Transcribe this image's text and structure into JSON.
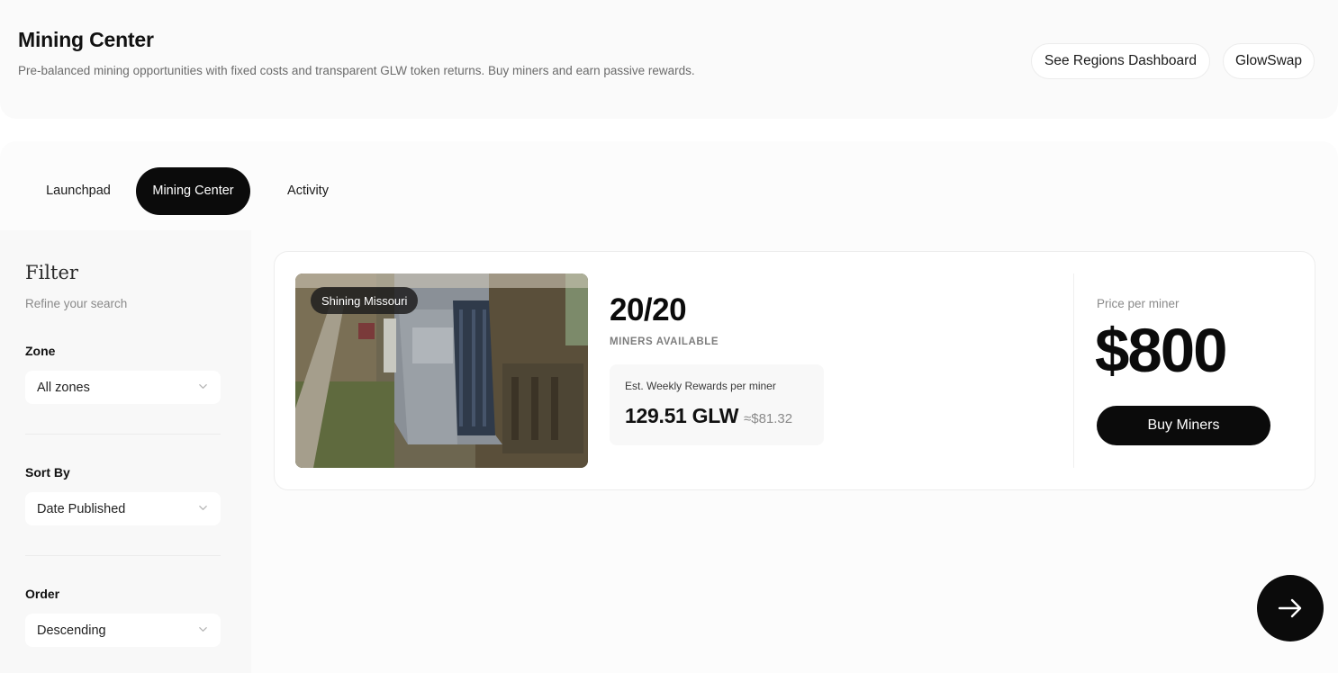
{
  "header": {
    "title": "Mining Center",
    "description": "Pre-balanced mining opportunities with fixed costs and transparent GLW token returns. Buy miners and earn passive rewards.",
    "regions_button": "See Regions Dashboard",
    "glowswap_button": "GlowSwap"
  },
  "tabs": [
    {
      "label": "Launchpad",
      "active": false
    },
    {
      "label": "Mining Center",
      "active": true
    },
    {
      "label": "Activity",
      "active": false
    }
  ],
  "filter": {
    "title": "Filter",
    "subtitle": "Refine your search",
    "zone": {
      "label": "Zone",
      "value": "All zones"
    },
    "sort_by": {
      "label": "Sort By",
      "value": "Date Published"
    },
    "order": {
      "label": "Order",
      "value": "Descending"
    }
  },
  "listing": {
    "location": "Shining Missouri",
    "available": "20/20",
    "available_label": "MINERS AVAILABLE",
    "rewards_label": "Est. Weekly Rewards per miner",
    "rewards_glw": "129.51 GLW",
    "rewards_usd": "≈$81.32",
    "price_label": "Price per miner",
    "price": "$800",
    "buy_button": "Buy Miners"
  },
  "icons": {
    "chevron": "chevron-down-icon",
    "fab": "arrow-right-icon"
  },
  "colors": {
    "primary": "#0b0b0b",
    "background": "#ffffff",
    "panel": "#fafafa",
    "muted_text": "#8a8a8a"
  }
}
